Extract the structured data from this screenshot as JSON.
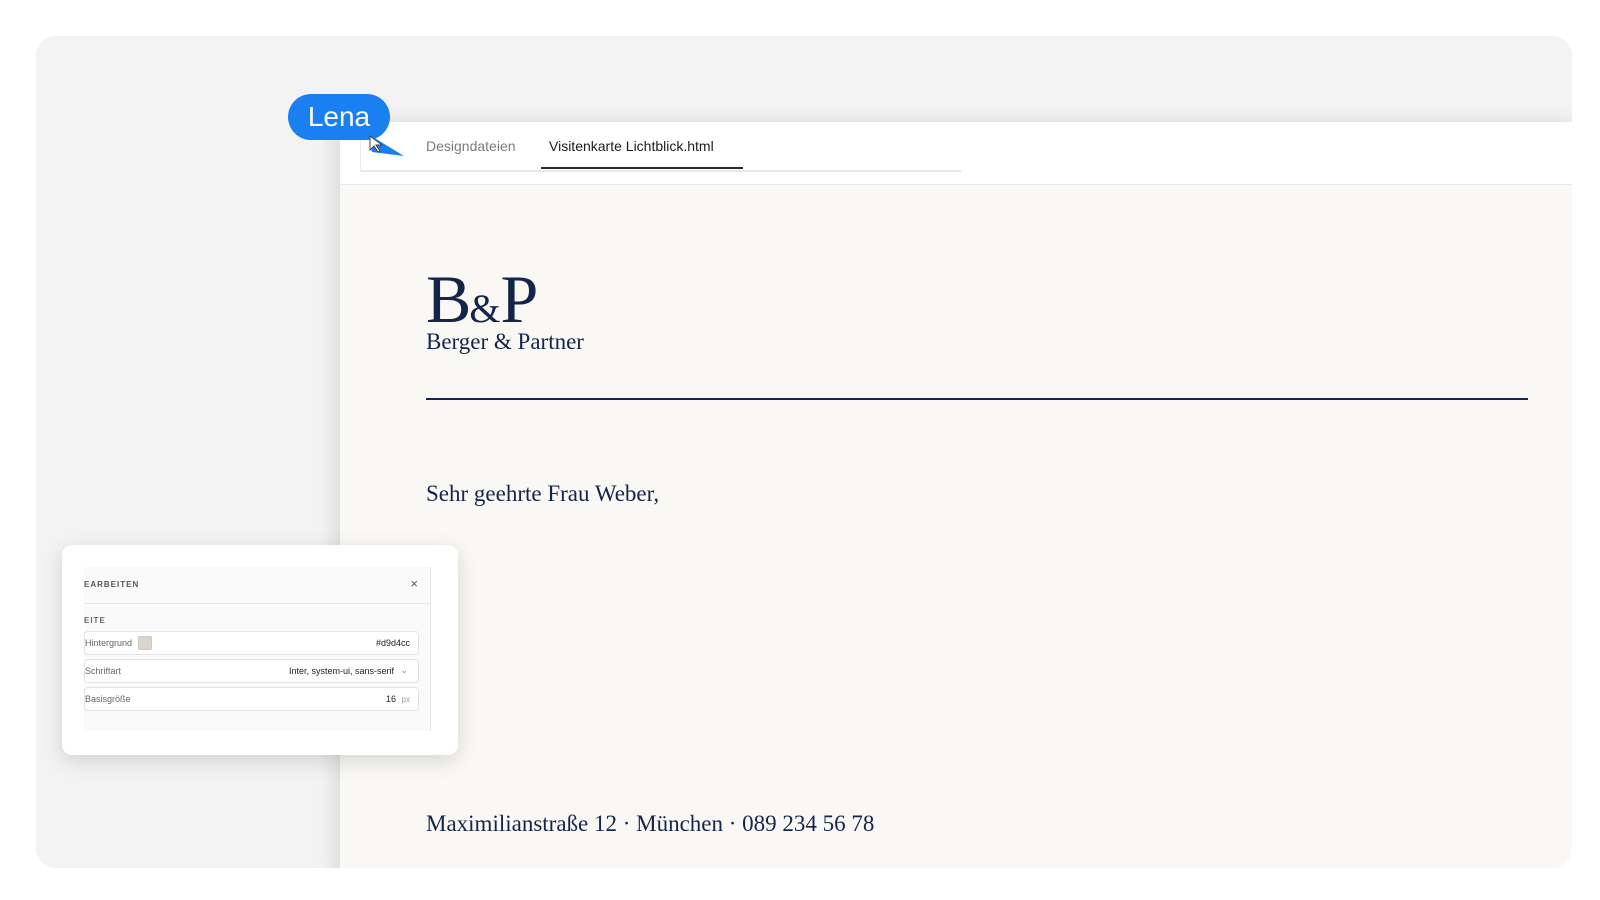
{
  "collaborator": {
    "name": "Lena",
    "color": "#1a7ff0"
  },
  "tabs": [
    {
      "label": "Designdateien",
      "active": false
    },
    {
      "label": "Visitenkarte Lichtblick.html",
      "active": true
    }
  ],
  "document": {
    "logo_mark": {
      "left": "B",
      "amp": "&",
      "right": "P"
    },
    "company_name": "Berger & Partner",
    "greeting": "Sehr geehrte Frau Weber,",
    "address_line": "Maximilianstraße 12 · München · 089 234 56 78",
    "brand_color": "#14254a",
    "paper_color": "#faf8f4"
  },
  "edit_panel": {
    "title": "EARBEITEN",
    "close_label": "×",
    "section_label": "EITE",
    "background": {
      "label": "Hintergrund",
      "value": "#d9d4cc"
    },
    "font": {
      "label": "Schriftart",
      "value": "Inter, system-ui, sans-serif",
      "chevron": "⌄"
    },
    "base_size": {
      "label": "Basisgröße",
      "value": "16",
      "unit": "px"
    }
  }
}
